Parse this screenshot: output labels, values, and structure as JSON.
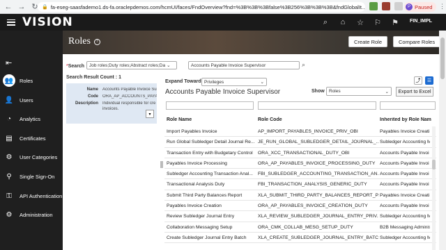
{
  "browser": {
    "url": "fa-eseg-saasfademo1.ds-fa.oraclepdemos.com/hcmUI/faces/FndOverview?fnd=%3B%3B%3Bfalse%3B256%3B%3B%3B&fndGlobalIt...",
    "profile_initial": "P",
    "profile_status": "Paused"
  },
  "app": {
    "brand": "VISION",
    "user": "FIN_IMPL"
  },
  "nav": {
    "items": [
      {
        "label": "Roles",
        "icon": "roles-icon"
      },
      {
        "label": "Users",
        "icon": "users-icon"
      },
      {
        "label": "Analytics",
        "icon": "analytics-icon"
      },
      {
        "label": "Certificates",
        "icon": "certificates-icon"
      },
      {
        "label": "User Categories",
        "icon": "user-categories-icon"
      },
      {
        "label": "Single Sign-On",
        "icon": "single-sign-on-icon"
      },
      {
        "label": "API Authentication",
        "icon": "api-authentication-icon"
      },
      {
        "label": "Administration",
        "icon": "administration-icon"
      }
    ]
  },
  "page": {
    "title": "Roles",
    "create_role": "Create Role",
    "compare_roles": "Compare Roles"
  },
  "search": {
    "label": "Search",
    "required_marker": "*",
    "type_value": "Job roles;Duty roles;Abstract roles;Da",
    "query_value": "Accounts Payable Invoice Supervisor",
    "result_count": "Search Result Count : 1"
  },
  "detail": {
    "name_label": "Name",
    "name_value": "Accounts Payable Invoice Su",
    "code_label": "Code",
    "code_value": "ORA_AP_ACCOUNTS_PAYAB",
    "description_label": "Description",
    "description_value_1": "Individual responsible for cre",
    "description_value_2": "invoices."
  },
  "tree": {
    "expand_label": "Expand Toward",
    "expand_value": "Privileges",
    "title": "Accounts Payable Invoice Supervisor",
    "show_label": "Show",
    "show_value": "Roles",
    "export_label": "Export to Excel",
    "columns": [
      "Role Name",
      "Role Code",
      "Inherited by Role Nam"
    ],
    "rows": [
      [
        "Import Payables Invoice",
        "AP_IMPORT_PAYABLES_INVOICE_PRIV_OBI",
        "Payables Invoice Creati"
      ],
      [
        "Run Global Subledger Detail Journal Re...",
        "JE_RUN_GLOBAL_SUBLEDGER_DETAIL_JOURNAL_...",
        "Subledger Accounting M"
      ],
      [
        "Transaction Entry with Budgetary Control",
        "ORA_XCC_TRANSACTIONAL_DUTY_OBI",
        "Accounts Payable Invoi"
      ],
      [
        "Payables Invoice Processing",
        "ORA_AP_PAYABLES_INVOICE_PROCESSING_DUTY",
        "Accounts Payable Invoi"
      ],
      [
        "Subledger Accounting Transaction Anal...",
        "FBI_SUBLEDGER_ACCOUNTING_TRANSACTION_AN...",
        "Accounts Payable Invoi"
      ],
      [
        "Transactional Analysis Duty",
        "FBI_TRANSACTION_ANALYSIS_GENERIC_DUTY",
        "Accounts Payable Invoi"
      ],
      [
        "Submit Third Party Balances Report",
        "XLA_SUBMIT_THIRD_PARTY_BALANCES_REPORT_P...",
        "Payables Invoice Creati"
      ],
      [
        "Payables Invoice Creation",
        "ORA_AP_PAYABLES_INVOICE_CREATION_DUTY",
        "Accounts Payable Invoi"
      ],
      [
        "Review Subledger Journal Entry",
        "XLA_REVIEW_SUBLEDGER_JOURNAL_ENTRY_PRIV...",
        "Subledger Accounting M"
      ],
      [
        "Collaboration Messaging Setup",
        "ORA_CMK_COLLAB_MESG_SETUP_DUTY",
        "B2B Messaging Adminis"
      ],
      [
        "Create Subledger Journal Entry Batch",
        "XLA_CREATE_SUBLEDGER_JOURNAL_ENTRY_BATC...",
        "Subledger Accounting M"
      ]
    ]
  }
}
